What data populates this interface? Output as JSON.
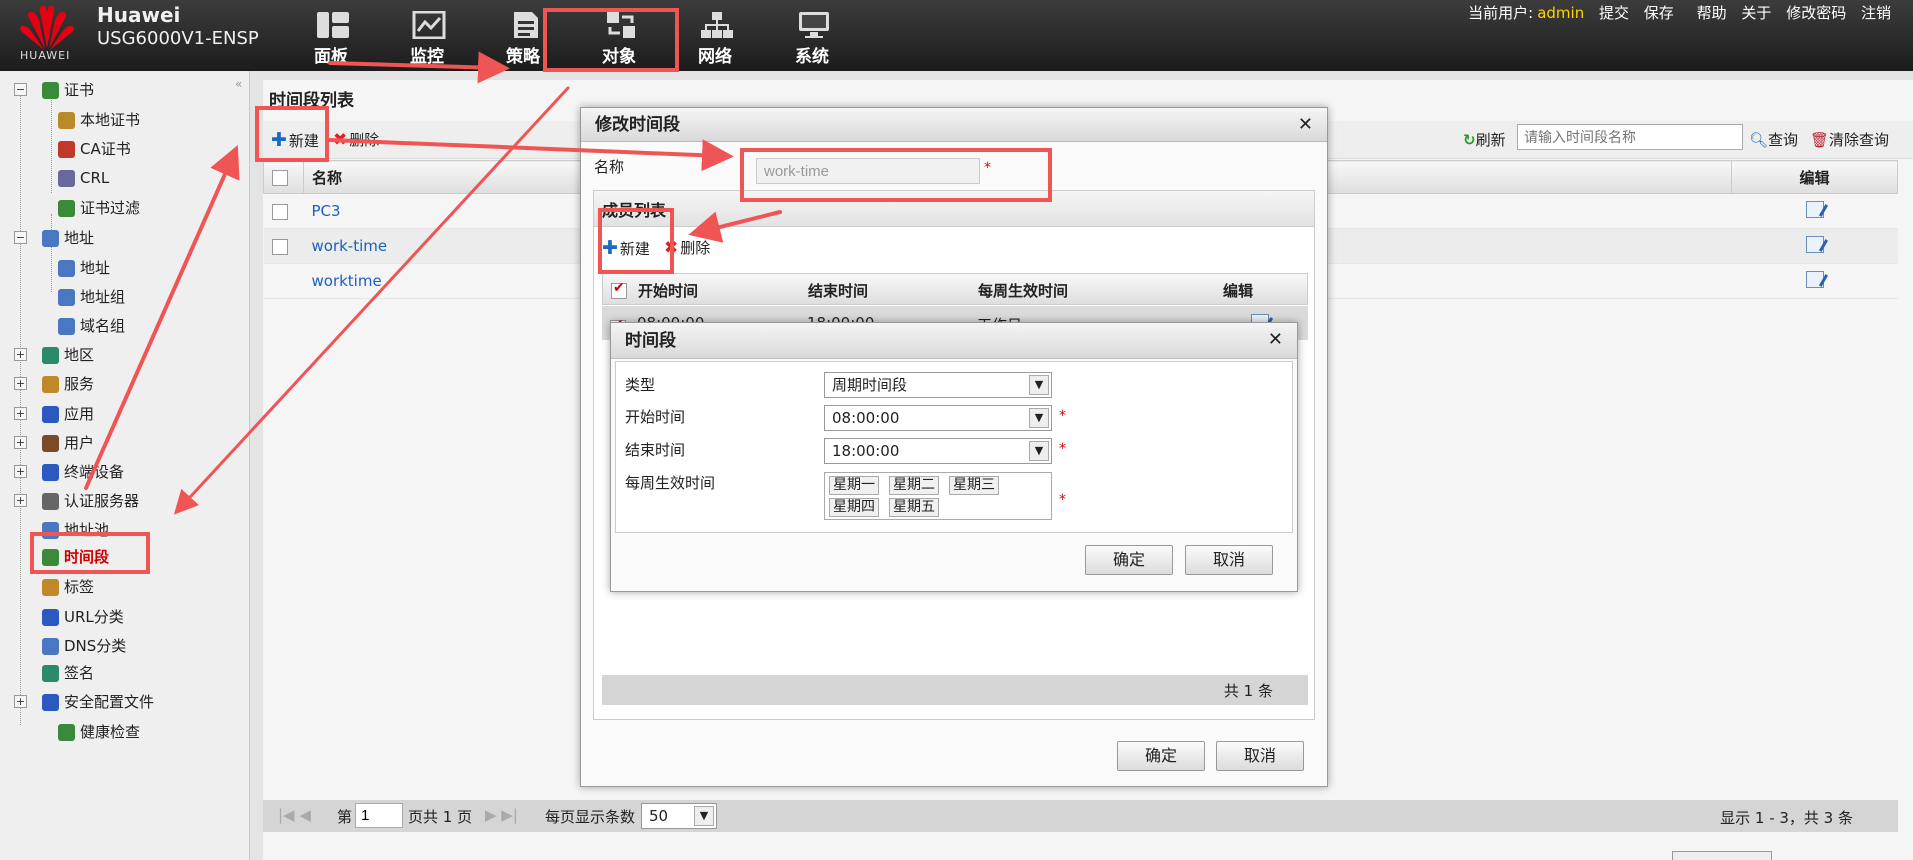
{
  "header": {
    "logo_text": "HUAWEI",
    "brand_name": "Huawei",
    "model": "USG6000V1-ENSP",
    "nav": [
      "面板",
      "监控",
      "策略",
      "对象",
      "网络",
      "系统"
    ],
    "current_user_label": "当前用户:",
    "current_user": "admin",
    "actions": [
      "提交",
      "保存",
      "帮助",
      "关于",
      "修改密码",
      "注销"
    ]
  },
  "sidebar": {
    "items": [
      {
        "label": "证书",
        "icon": "certificate-icon"
      },
      {
        "label": "本地证书",
        "icon": "local-certificate-icon"
      },
      {
        "label": "CA证书",
        "icon": "ca-certificate-icon"
      },
      {
        "label": "CRL",
        "icon": "crl-icon"
      },
      {
        "label": "证书过滤",
        "icon": "certificate-filter-icon"
      },
      {
        "label": "地址",
        "icon": "address-icon"
      },
      {
        "label": "地址",
        "icon": "address-item-icon"
      },
      {
        "label": "地址组",
        "icon": "address-group-icon"
      },
      {
        "label": "域名组",
        "icon": "domain-group-icon"
      },
      {
        "label": "地区",
        "icon": "region-icon"
      },
      {
        "label": "服务",
        "icon": "service-icon"
      },
      {
        "label": "应用",
        "icon": "application-icon"
      },
      {
        "label": "用户",
        "icon": "user-icon"
      },
      {
        "label": "终端设备",
        "icon": "terminal-device-icon"
      },
      {
        "label": "认证服务器",
        "icon": "auth-server-icon"
      },
      {
        "label": "地址池",
        "icon": "address-pool-icon"
      },
      {
        "label": "时间段",
        "icon": "time-range-icon"
      },
      {
        "label": "标签",
        "icon": "tag-icon"
      },
      {
        "label": "URL分类",
        "icon": "url-category-icon"
      },
      {
        "label": "DNS分类",
        "icon": "dns-category-icon"
      },
      {
        "label": "签名",
        "icon": "signature-icon"
      },
      {
        "label": "安全配置文件",
        "icon": "security-profile-icon"
      },
      {
        "label": "健康检查",
        "icon": "health-check-icon"
      }
    ],
    "expand_symbol": "+",
    "collapse_symbol": "−"
  },
  "list_panel": {
    "title": "时间段列表",
    "new_label": "新建",
    "delete_label": "删除",
    "refresh_label": "刷新",
    "search_placeholder": "请输入时间段名称",
    "query_label": "查询",
    "clear_query_label": "清除查询",
    "col_name": "名称",
    "col_edit": "编辑",
    "rows": [
      {
        "name": "PC3"
      },
      {
        "name": "work-time"
      },
      {
        "name": "worktime"
      }
    ],
    "pager": {
      "page_prefix": "第",
      "page": "1",
      "page_suffix": "页共 1 页",
      "per_page_label": "每页显示条数",
      "per_page": "50",
      "summary": "显示 1 - 3，共 3 条"
    }
  },
  "modify_dialog": {
    "title": "修改时间段",
    "name_label": "名称",
    "name_value": "work-time",
    "members_title": "成员列表",
    "new_label": "新建",
    "delete_label": "删除",
    "columns": [
      "开始时间",
      "结束时间",
      "每周生效时间",
      "编辑"
    ],
    "row": {
      "start": "08:00:00",
      "end": "18:00:00",
      "days": "工作日"
    },
    "total": "共 1 条",
    "ok_label": "确定",
    "cancel_label": "取消"
  },
  "time_dialog": {
    "title": "时间段",
    "type_label": "类型",
    "type_value": "周期时间段",
    "start_label": "开始时间",
    "start_value": "08:00:00",
    "end_label": "结束时间",
    "end_value": "18:00:00",
    "days_label": "每周生效时间",
    "days": [
      "星期一",
      "星期二",
      "星期三",
      "星期四",
      "星期五"
    ],
    "required_mark": "*",
    "ok_label": "确定",
    "cancel_label": "取消"
  },
  "colors": {
    "accent_user": "#ffd400",
    "link": "#1a5fc2",
    "annotation": "#f05555",
    "required": "#dd0000"
  }
}
